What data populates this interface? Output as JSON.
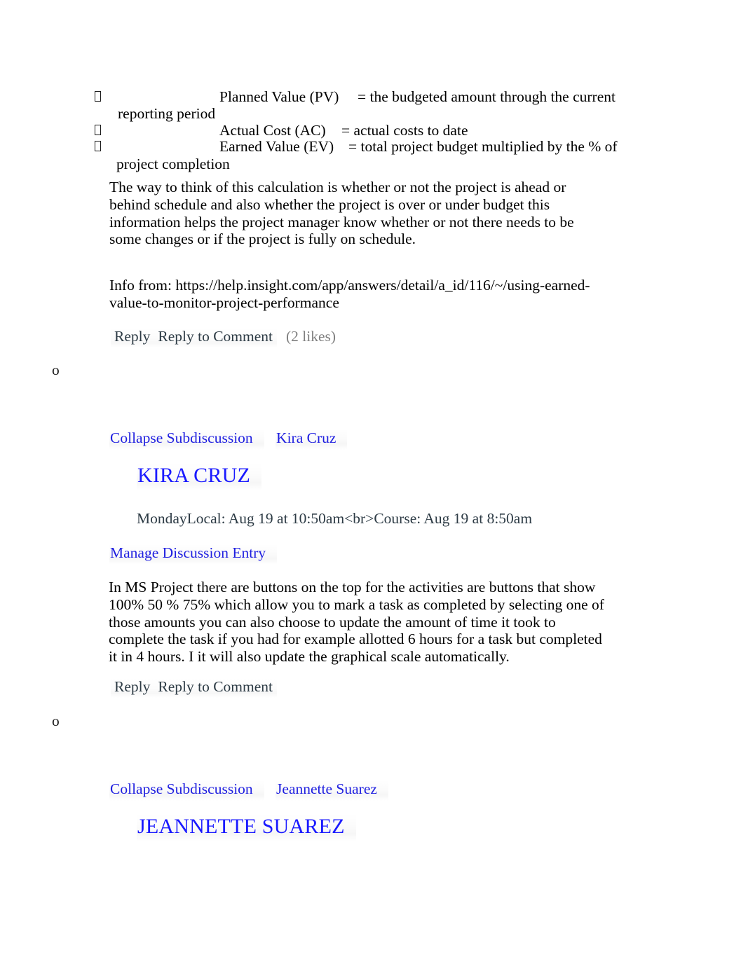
{
  "document": {
    "page_background": "#ffffff",
    "link_color": "#1f1fe0",
    "heading_color": "#1a1aff",
    "reply_color": "#2d3b45",
    "likes_color": "#7f7f7f"
  },
  "definitions": [
    {
      "bullet": "missing-glyph-box",
      "term": "Planned Value (PV)",
      "definition": "= the budgeted amount through the current",
      "continuation": "reporting period"
    },
    {
      "bullet": "missing-glyph-box",
      "term": "Actual Cost (AC)",
      "definition": "= actual costs to date",
      "continuation": ""
    },
    {
      "bullet": "missing-glyph-box",
      "term": "Earned Value (EV)",
      "definition": "= total project budget multiplied by the % of",
      "continuation": "project completion"
    }
  ],
  "explanation_paragraph": "The way to think of this calculation is whether or not the project is ahead or behind schedule and also whether the project is over or under budget this information helps the project manager know whether or not there needs to be some changes or if the project is fully on schedule.",
  "source_paragraph": "Info from: https://help.insight.com/app/answers/detail/a_id/116/~/using-earned-value-to-monitor-project-performance",
  "reply_bar_1": {
    "reply_label": "Reply",
    "reply_to_comment_label": "Reply to Comment",
    "likes_label": "(2 likes)"
  },
  "list_marker_1": "o",
  "entry_kira": {
    "collapse_label": "Collapse Subdiscussion",
    "author_link": "Kira Cruz",
    "author_heading": "KIRA CRUZ",
    "timestamp": "MondayLocal: Aug 19 at 10:50am<br>Course: Aug 19 at 8:50am",
    "manage_entry_label": "Manage Discussion Entry",
    "message": "In MS Project there are buttons on the top for the activities are buttons that show 100% 50 % 75% which allow you to mark a task as completed by selecting one of those amounts you can also choose to update the amount of time it took to complete the task if you had for example allotted 6 hours for a task but completed it in 4 hours. I it will also update the graphical scale automatically.",
    "reply_bar": {
      "reply_label": "Reply",
      "reply_to_comment_label": "Reply to Comment"
    }
  },
  "list_marker_2": "o",
  "entry_jeannette": {
    "collapse_label": "Collapse Subdiscussion",
    "author_link": "Jeannette Suarez",
    "author_heading": "JEANNETTE SUAREZ"
  }
}
